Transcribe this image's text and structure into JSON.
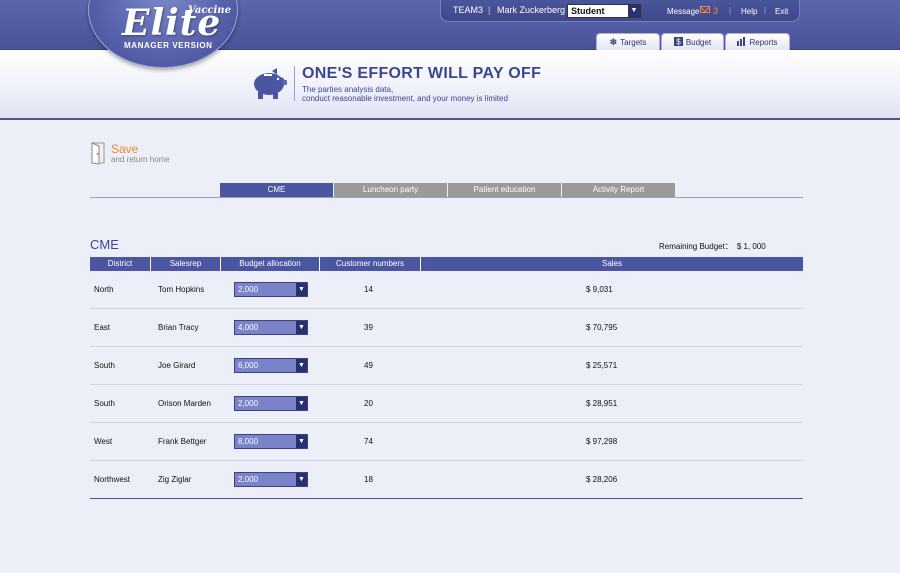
{
  "header": {
    "logo": {
      "title": "Elite",
      "superscript": "Vaccine",
      "subtitle": "MANAGER VERSION"
    },
    "user_bar": {
      "team": "TEAM3",
      "separator": "|",
      "user_name": "Mark Zuckerberg",
      "role_select": {
        "value": "Student"
      },
      "message_label": "Message",
      "message_count": "3",
      "help_label": "Help",
      "exit_label": "Exit"
    },
    "nav_tabs": [
      {
        "label": "Targets",
        "icon": "globe-icon"
      },
      {
        "label": "Budget",
        "icon": "dollar-icon"
      },
      {
        "label": "Reports",
        "icon": "bar-chart-icon"
      }
    ],
    "banner": {
      "slogan": "ONE'S EFFORT WILL PAY OFF",
      "sub_line1": "The parties analysis data,",
      "sub_line2": "conduct reasonable investment, and your money is limited",
      "icon": "piggy-bank-icon"
    }
  },
  "save": {
    "title": "Save",
    "subtitle": "and return home",
    "icon": "door-icon"
  },
  "sub_tabs": [
    {
      "label": "CME",
      "active": true
    },
    {
      "label": "Luncheon party",
      "active": false
    },
    {
      "label": "Patient education",
      "active": false
    },
    {
      "label": "Activity Report",
      "active": false
    }
  ],
  "section": {
    "title": "CME",
    "remaining_label": "Remaining Budget：",
    "remaining_value": "$ 1, 000"
  },
  "table": {
    "headers": [
      "District",
      "Salesrep",
      "Budget allocation",
      "Customer numbers",
      "Sales"
    ],
    "rows": [
      {
        "district": "North",
        "salesrep": "Tom Hopkins",
        "budget": "2,000",
        "customers": "14",
        "sales": "$  9,031"
      },
      {
        "district": "East",
        "salesrep": "Brian Tracy",
        "budget": "4,000",
        "customers": "39",
        "sales": "$  70,795"
      },
      {
        "district": "South",
        "salesrep": "Joe Girard",
        "budget": "6,000",
        "customers": "49",
        "sales": "$  25,571"
      },
      {
        "district": "South",
        "salesrep": "Orison Marden",
        "budget": "2,000",
        "customers": "20",
        "sales": "$  28,951"
      },
      {
        "district": "West",
        "salesrep": "Frank Bettger",
        "budget": "8,000",
        "customers": "74",
        "sales": "$  97,298"
      },
      {
        "district": "Northwest",
        "salesrep": "Zig Ziglar",
        "budget": "2,000",
        "customers": "18",
        "sales": "$  28,206"
      }
    ]
  },
  "colors": {
    "header_blue": "#4a5398",
    "accent_orange": "#ef8a2c",
    "table_header": "#4b56a2",
    "inactive_tab": "#9a9a9a"
  }
}
